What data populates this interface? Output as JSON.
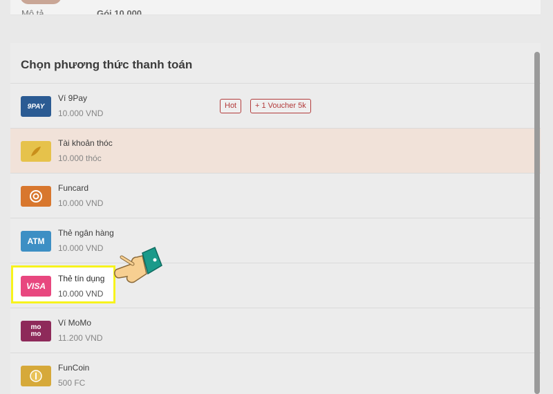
{
  "top_summary": {
    "label": "Mô tả",
    "value": "Gói 10.000"
  },
  "section_title": "Chọn phương thức thanh toán",
  "methods": [
    {
      "name": "Ví 9Pay",
      "price": "10.000 VND",
      "icon": "9pay-icon",
      "icon_text": "9PAY",
      "icon_color": "#2b5b93",
      "badges": [
        "Hot",
        "+ 1 Voucher 5k"
      ]
    },
    {
      "name": "Tài khoản thóc",
      "price": "10.000 thóc",
      "icon": "rice-grain-icon",
      "icon_color": "#e6c24b"
    },
    {
      "name": "Funcard",
      "price": "10.000 VND",
      "icon": "funcard-icon",
      "icon_color": "#d8772e"
    },
    {
      "name": "Thẻ ngân hàng",
      "price": "10.000 VND",
      "icon": "atm-icon",
      "icon_text": "ATM",
      "icon_color": "#3d8fc4"
    },
    {
      "name": "Thẻ tín dụng",
      "price": "10.000 VND",
      "icon": "visa-icon",
      "icon_text": "VISA",
      "icon_color": "#e8477f"
    },
    {
      "name": "Ví MoMo",
      "price": "11.200 VND",
      "icon": "momo-icon",
      "icon_text": "mo mo",
      "icon_color": "#8e2a5a"
    },
    {
      "name": "FunCoin",
      "price": "500 FC",
      "icon": "funcoin-icon",
      "icon_color": "#d6a93a"
    }
  ],
  "highlight_color": "#f7f31c"
}
